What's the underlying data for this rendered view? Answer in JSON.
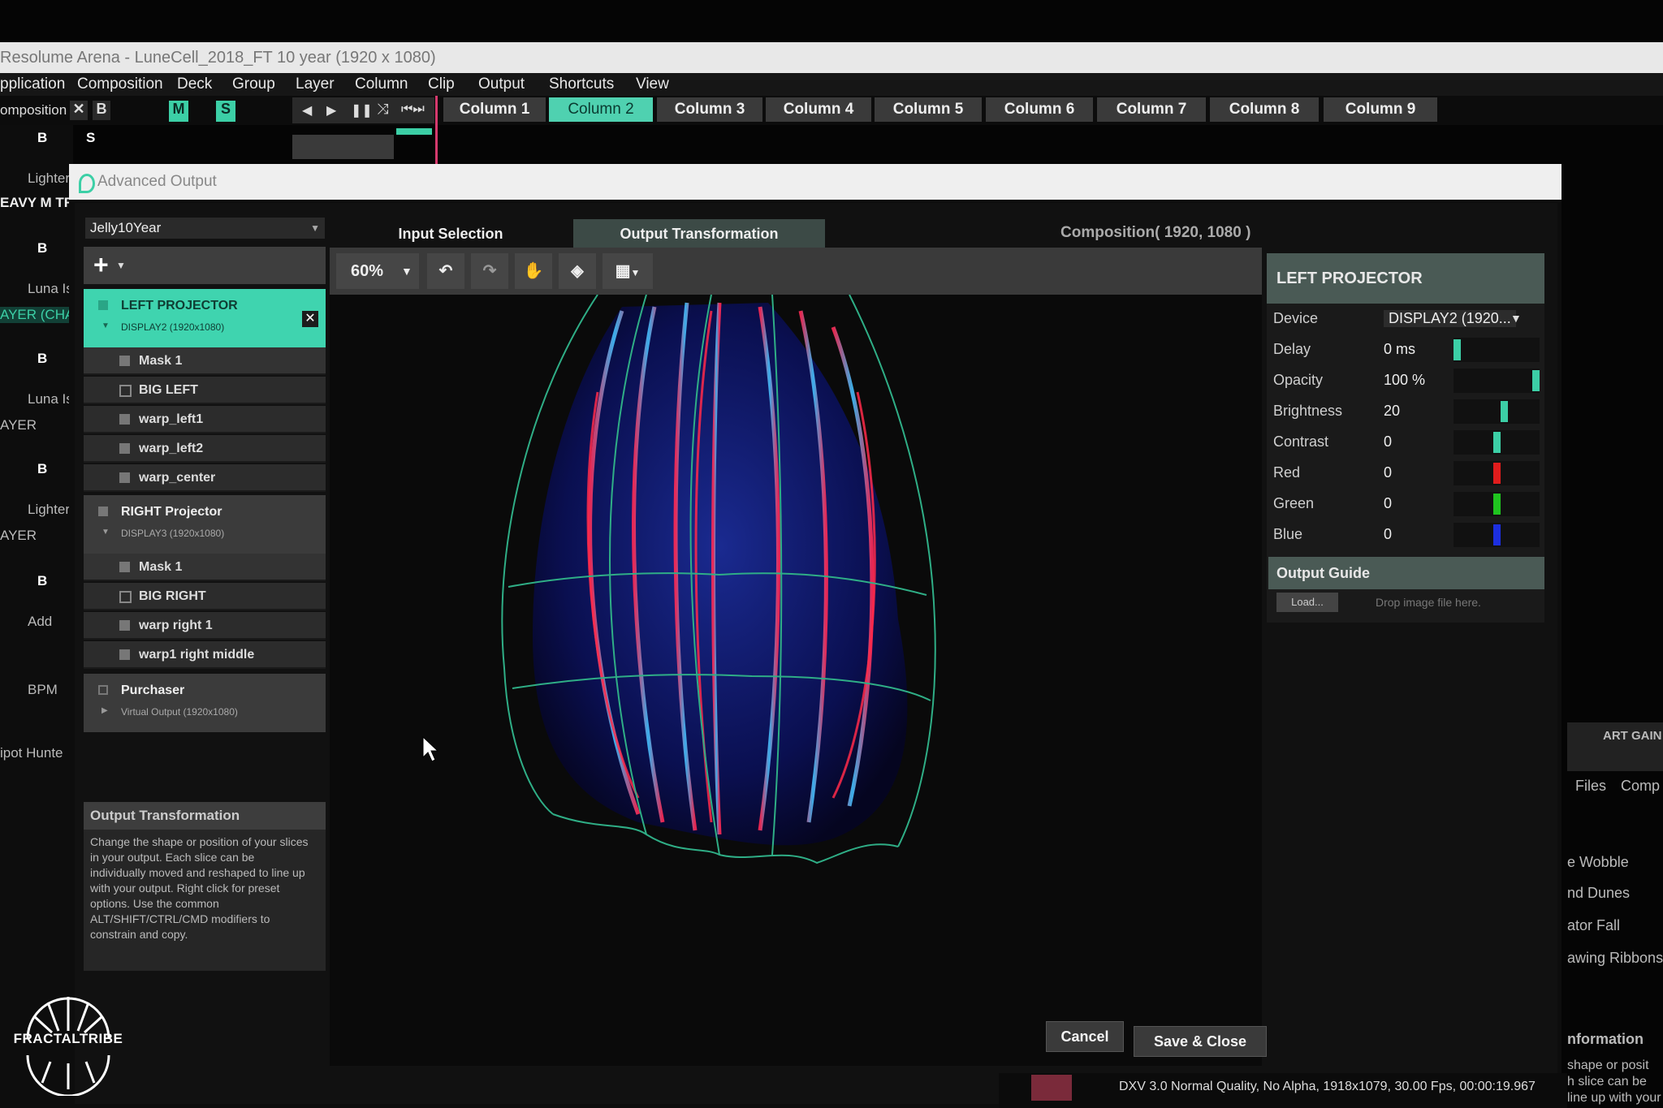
{
  "app": {
    "title": "Resolume Arena - LuneCell_2018_FT 10 year (1920 x 1080)",
    "menu": [
      "pplication",
      "Composition",
      "Deck",
      "Group",
      "Layer",
      "Column",
      "Clip",
      "Output",
      "Shortcuts",
      "View"
    ],
    "composition_label": "omposition",
    "toggle_x": "✕",
    "toggle_b": "B",
    "toggle_m": "M",
    "toggle_s": "S",
    "columns": [
      "Column 1",
      "Column 2",
      "Column 3",
      "Column 4",
      "Column 5",
      "Column 6",
      "Column 7",
      "Column 8",
      "Column 9"
    ],
    "active_column": "Column 2",
    "left_strip": [
      "B",
      "S",
      "Lighter",
      "EAVY M TR",
      "B",
      "Luna Is A",
      "AYER (CHA",
      "B",
      "Luna Is A",
      "AYER",
      "B",
      "Lighter",
      "AYER",
      "B",
      "Add",
      "BPM",
      "ipot Hunte"
    ]
  },
  "dialog": {
    "title": "Advanced Output",
    "preset": "Jelly10Year",
    "tabs": [
      "Input Selection",
      "Output Transformation"
    ],
    "active_tab": "Output Transformation",
    "composition_info": "Composition( 1920, 1080 )",
    "zoom": "60%",
    "tree": {
      "left_projector": {
        "name": "LEFT PROJECTOR",
        "device": "DISPLAY2 (1920x1080)",
        "slices": [
          "Mask 1",
          "BIG LEFT",
          "warp_left1",
          "warp_left2",
          "warp_center"
        ]
      },
      "right_projector": {
        "name": "RIGHT Projector",
        "device": "DISPLAY3 (1920x1080)",
        "slices": [
          "Mask 1",
          "BIG RIGHT",
          "warp right 1",
          "warp1 right middle"
        ]
      },
      "purchaser": {
        "name": "Purchaser",
        "device": "Virtual Output (1920x1080)"
      }
    },
    "help": {
      "title": "Output Transformation",
      "body": "Change the shape or position of your slices in your output. Each slice can be individually moved and reshaped to line up with your output. Right click for preset options. Use the common ALT/SHIFT/CTRL/CMD modifiers to constrain and copy."
    },
    "properties": {
      "title": "LEFT PROJECTOR",
      "rows": [
        {
          "label": "Device",
          "value": "DISPLAY2 (1920..."
        },
        {
          "label": "Delay",
          "value": "0 ms",
          "level": 0.0,
          "color": "#3ccfa6"
        },
        {
          "label": "Opacity",
          "value": "100 %",
          "level": 1.0,
          "color": "#3ccfa6"
        },
        {
          "label": "Brightness",
          "value": "20",
          "level": 0.6,
          "color": "#3ccfa6"
        },
        {
          "label": "Contrast",
          "value": "0",
          "level": 0.5,
          "color": "#3ccfa6"
        },
        {
          "label": "Red",
          "value": "0",
          "level": 0.5,
          "color": "#e01c1c"
        },
        {
          "label": "Green",
          "value": "0",
          "level": 0.5,
          "color": "#1fc41f"
        },
        {
          "label": "Blue",
          "value": "0",
          "level": 0.5,
          "color": "#1c2fe0"
        }
      ],
      "guide_title": "Output Guide",
      "load_label": "Load...",
      "drop_hint": "Drop image file here."
    },
    "buttons": {
      "cancel": "Cancel",
      "save": "Save & Close"
    }
  },
  "background_right": [
    "ART GAIN",
    "Files",
    "Comp",
    "e Wobble",
    "nd Dunes",
    "ator Fall",
    "awing Ribbons",
    "nformation",
    "shape or posit",
    "h slice can be",
    "line up with your"
  ],
  "clip_info": "DXV 3.0 Normal Quality, No Alpha, 1918x1079, 30.00 Fps, 00:00:19.967",
  "brand": "FRACTALTRIBE",
  "colors": {
    "accent": "#3ccfa6",
    "outline": "#2fae86"
  }
}
